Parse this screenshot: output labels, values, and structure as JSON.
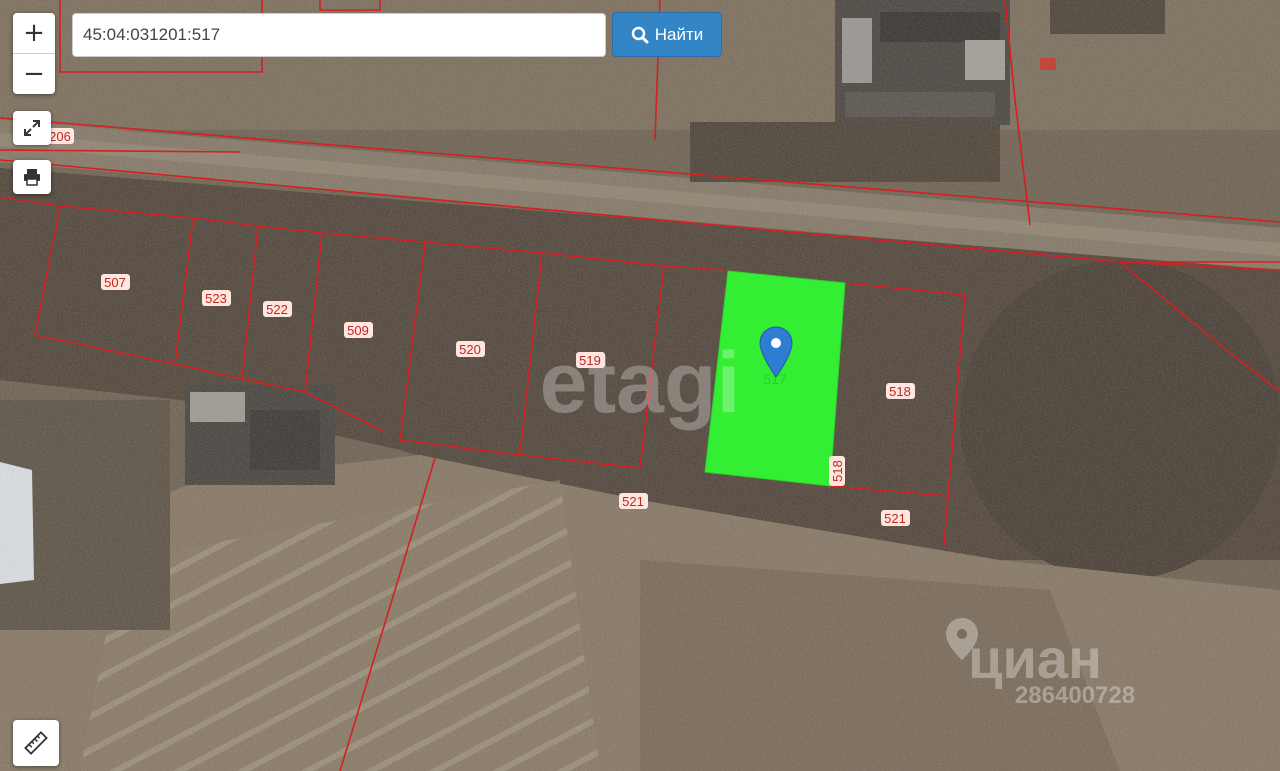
{
  "search": {
    "value": "45:04:031201:517",
    "button_label": "Найти"
  },
  "zoom": {
    "in_label": "+",
    "out_label": "−"
  },
  "icons": {
    "zoom_in": "plus-icon",
    "zoom_out": "minus-icon",
    "fullscreen": "expand-icon",
    "print": "printer-icon",
    "search": "magnifier-icon",
    "measure": "ruler-icon",
    "marker": "location-pin-icon"
  },
  "colors": {
    "boundary": "#d42020",
    "selected_parcel": "#33ee33",
    "marker": "#2d7dd2",
    "search_button": "#3385c6"
  },
  "parcels": {
    "p206": "206",
    "p507": "507",
    "p523": "523",
    "p522": "522",
    "p509": "509",
    "p520": "520",
    "p519": "519",
    "p518": "518",
    "p518b": "518",
    "p521": "521",
    "p521b": "521"
  },
  "selected_parcel_label": "517",
  "watermarks": {
    "etagi": "etagi",
    "cian": "циан",
    "cian_id": "286400728"
  }
}
